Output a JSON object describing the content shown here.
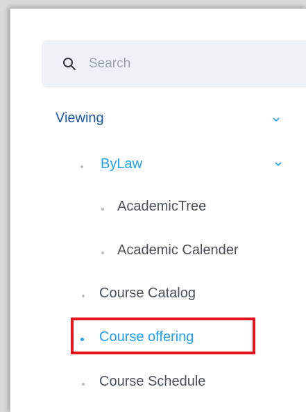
{
  "search": {
    "placeholder": "Search"
  },
  "nav": {
    "viewing": {
      "label": "Viewing",
      "color": "#1b56a6"
    },
    "bylaw": {
      "label": "ByLaw",
      "color": "#1ea1f2"
    },
    "academic_tree": {
      "label": "AcademicTree"
    },
    "academic_calender": {
      "label": "Academic Calender"
    },
    "course_catalog": {
      "label": "Course Catalog"
    },
    "course_offering": {
      "label": "Course offering",
      "color": "#1ea1f2",
      "active": true
    },
    "course_schedule": {
      "label": "Course Schedule"
    }
  },
  "colors": {
    "highlight": "#e8141b",
    "text": "#4a5058",
    "search_bg": "#eef2f6"
  },
  "icons": {
    "search": "search-icon",
    "chevron": "chevron-down-icon"
  }
}
